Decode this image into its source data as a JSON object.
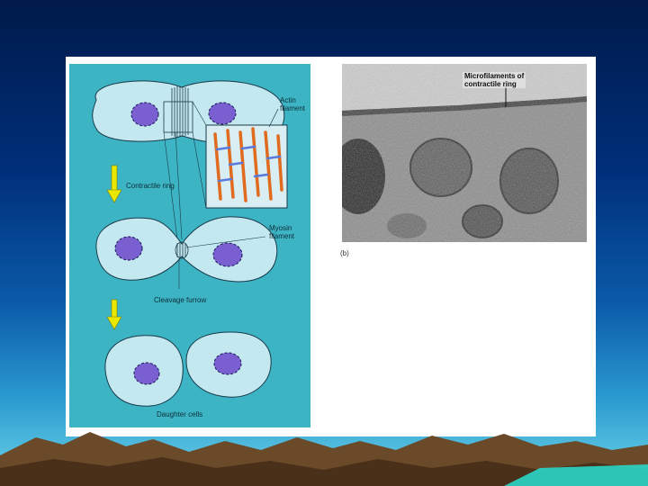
{
  "diagram": {
    "labels": {
      "actin_filament": "Actin\nfilament",
      "contractile_ring": "Contractile ring",
      "myosin_filament": "Myosin\nfilament",
      "cleavage_furrow": "Cleavage furrow",
      "daughter_cells": "Daughter cells"
    }
  },
  "micrograph": {
    "label": "Microfilaments of\ncontractile ring",
    "panel_letter": "(b)"
  },
  "colors": {
    "panel_bg": "#3cb4c4",
    "cell_fill": "#c4e8ef",
    "nucleus": "#7a5fd0",
    "arrow": "#e8e800",
    "filament": "#e06a1e"
  }
}
